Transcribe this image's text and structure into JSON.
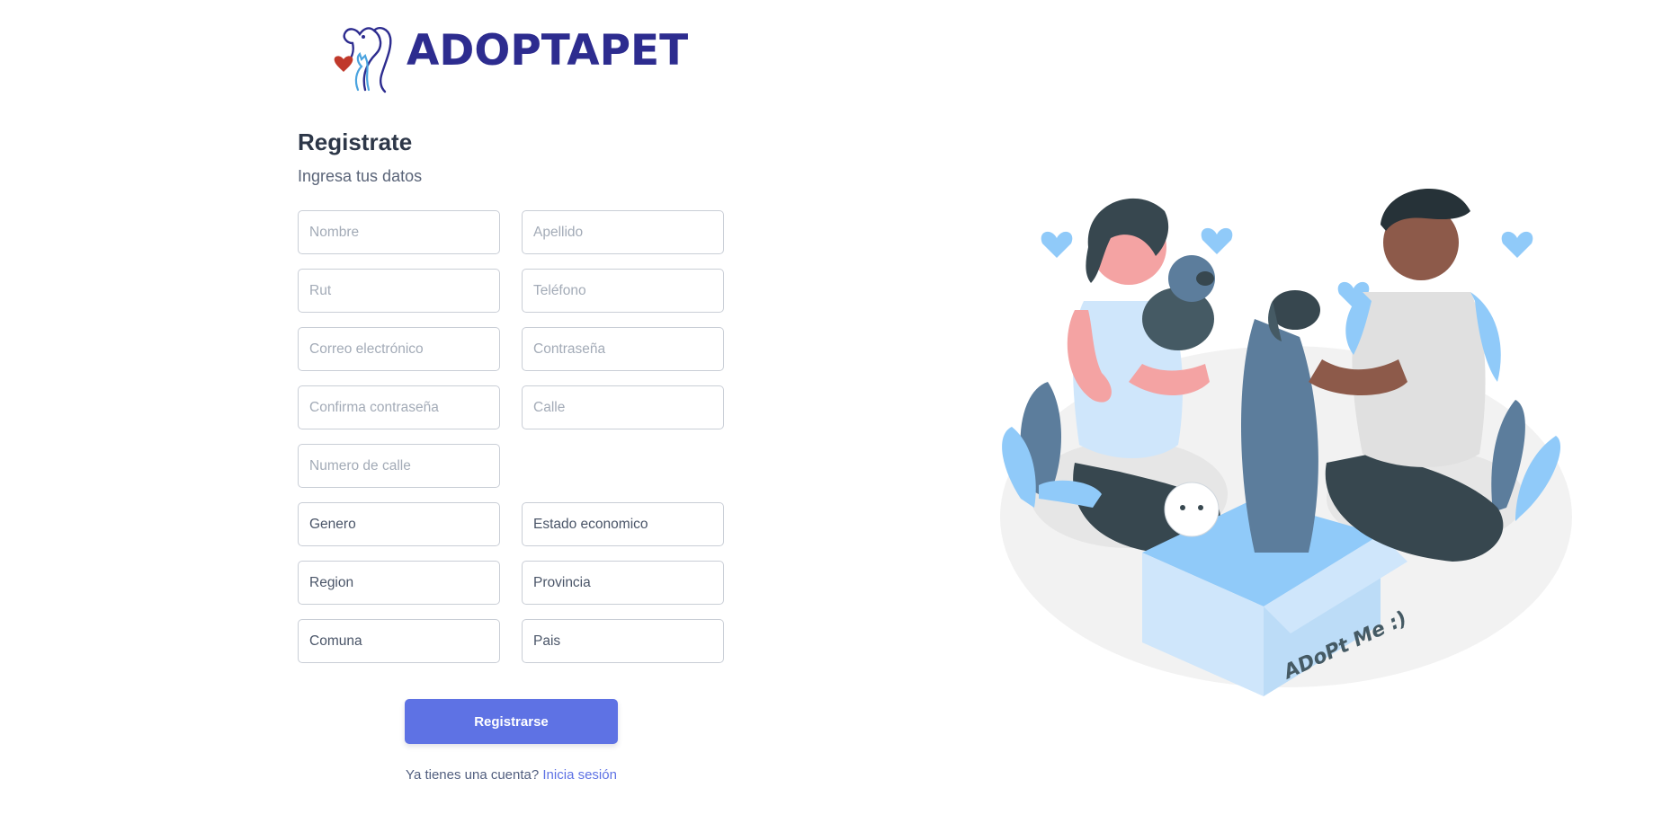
{
  "brand": {
    "name": "ADOPTAPET",
    "color": "#2d2c8f",
    "accent_heart": "#c0392b",
    "accent_blue": "#4aa3df"
  },
  "form": {
    "title": "Registrate",
    "subtitle": "Ingresa tus datos",
    "fields": {
      "nombre": "Nombre",
      "apellido": "Apellido",
      "rut": "Rut",
      "telefono": "Teléfono",
      "correo": "Correo electrónico",
      "contrasena": "Contraseña",
      "confirma": "Confirma contraseña",
      "calle": "Calle",
      "numero_calle": "Numero de calle"
    },
    "selects": {
      "genero": "Genero",
      "estado_economico": "Estado economico",
      "region": "Region",
      "provincia": "Provincia",
      "comuna": "Comuna",
      "pais": "Pais"
    },
    "submit_label": "Registrarse",
    "login_prompt": "Ya tienes una cuenta?",
    "login_link": "Inicia sesión"
  },
  "illustration": {
    "box_text": "ADoPt Me :)",
    "colors": {
      "primary": "#5e72e4",
      "light_blue": "#90caf9",
      "dark": "#37474f",
      "floor": "#f0f0f0"
    }
  }
}
